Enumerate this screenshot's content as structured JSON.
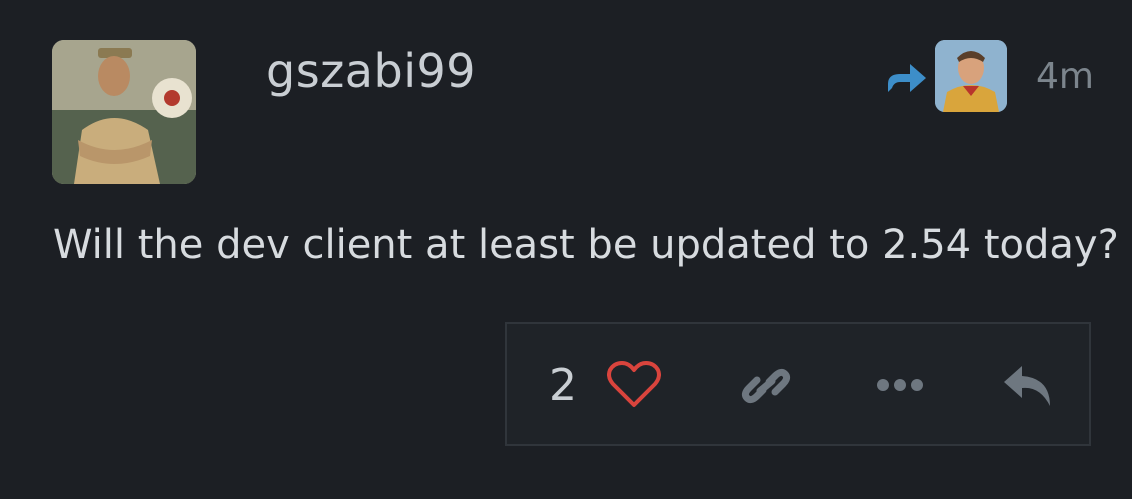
{
  "post": {
    "username": "gszabi99",
    "timestamp": "4m",
    "body": "Will the dev client at least be updated to 2.54 today?",
    "like_count": "2"
  },
  "icons": {
    "avatar": "user-avatar",
    "reply_to_avatar": "reply-to-user-avatar",
    "reply_arrow": "reply-arrow-icon",
    "like": "heart-icon",
    "link": "link-icon",
    "more": "ellipsis-icon",
    "reply": "reply-icon"
  },
  "colors": {
    "background": "#1c1f24",
    "text": "#d7dbdf",
    "muted": "#7c858d",
    "heart": "#d9443d",
    "reply_arrow": "#3d8ec9",
    "icon": "#6e7780"
  }
}
